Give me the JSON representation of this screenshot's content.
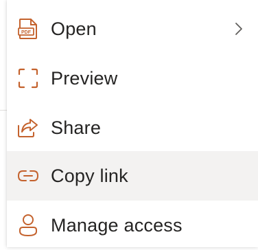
{
  "colors": {
    "accent": "#c4622d",
    "text": "#252423",
    "hover_bg": "#f3f2f1",
    "chevron": "#605e5c"
  },
  "menu": {
    "items": [
      {
        "label": "Open",
        "icon": "pdf-file-icon",
        "has_submenu": true
      },
      {
        "label": "Preview",
        "icon": "preview-frame-icon",
        "has_submenu": false
      },
      {
        "label": "Share",
        "icon": "share-icon",
        "has_submenu": false
      },
      {
        "label": "Copy link",
        "icon": "link-icon",
        "has_submenu": false,
        "hovered": true
      },
      {
        "label": "Manage access",
        "icon": "person-icon",
        "has_submenu": false
      }
    ],
    "pdf_badge": "PDF"
  }
}
